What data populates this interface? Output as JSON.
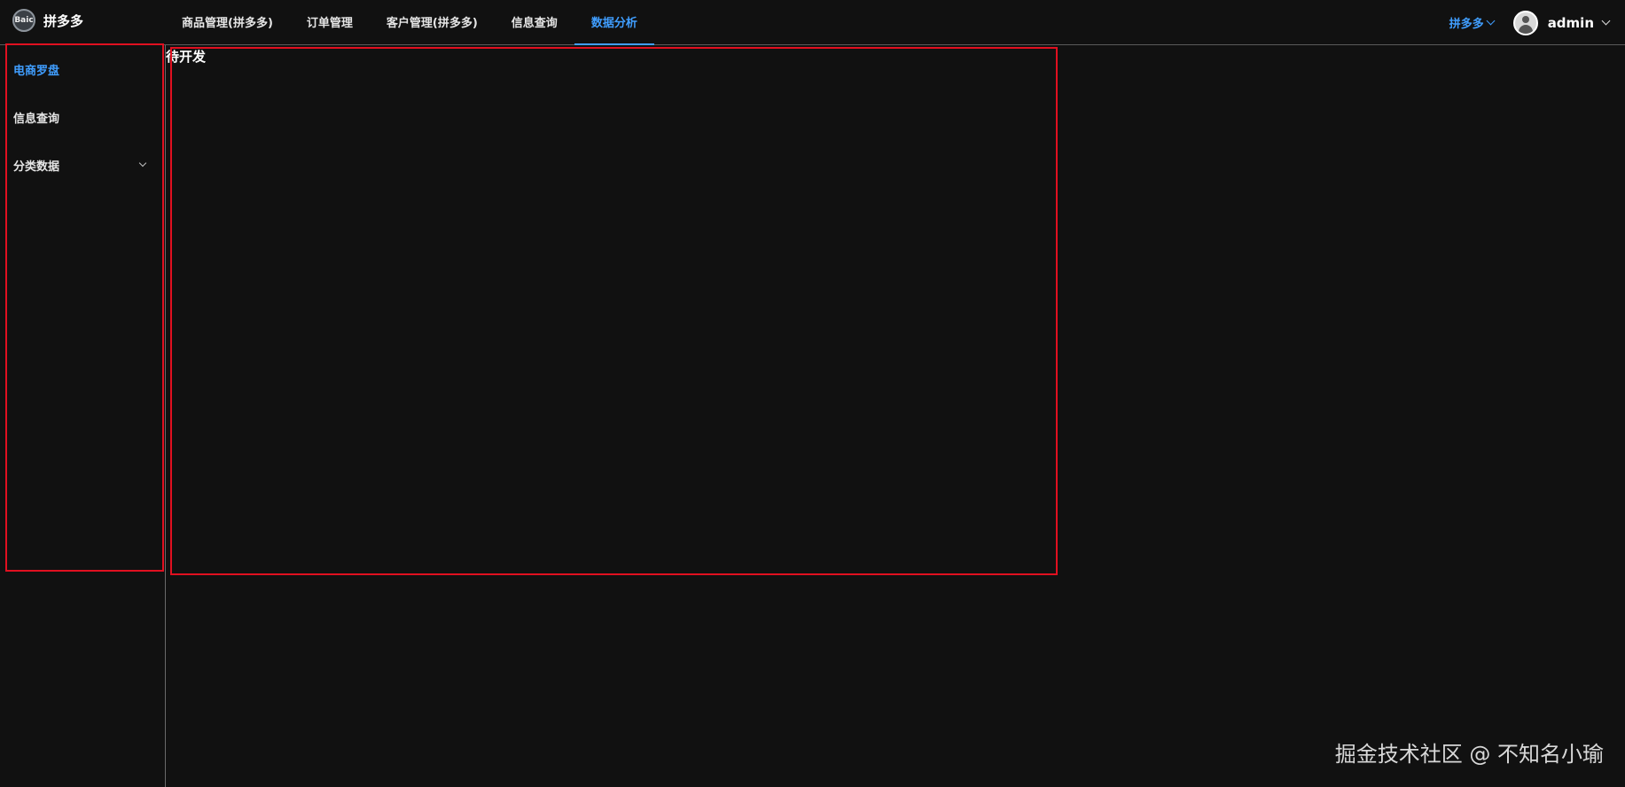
{
  "header": {
    "brand": {
      "logo_text": "Baic",
      "title": "拼多多"
    },
    "nav": [
      {
        "label": "商品管理(拼多多)",
        "active": false
      },
      {
        "label": "订单管理",
        "active": false
      },
      {
        "label": "客户管理(拼多多)",
        "active": false
      },
      {
        "label": "信息查询",
        "active": false
      },
      {
        "label": "数据分析",
        "active": true
      }
    ],
    "platform_select": {
      "value": "拼多多"
    },
    "user": {
      "name": "admin"
    }
  },
  "sidebar": {
    "items": [
      {
        "label": "电商罗盘",
        "active": true
      },
      {
        "label": "信息查询",
        "active": false
      },
      {
        "label": "分类数据",
        "active": false,
        "expandable": true
      }
    ]
  },
  "content": {
    "title": "待开发"
  },
  "watermark": "掘金技术社区 @ 不知名小瑜",
  "colors": {
    "accent": "#409eff",
    "background": "#111111",
    "highlight": "#e01020"
  },
  "icons": {
    "brand_logo": "brand-logo-icon",
    "avatar": "user-avatar-icon",
    "chevron": "chevron-down-icon"
  }
}
